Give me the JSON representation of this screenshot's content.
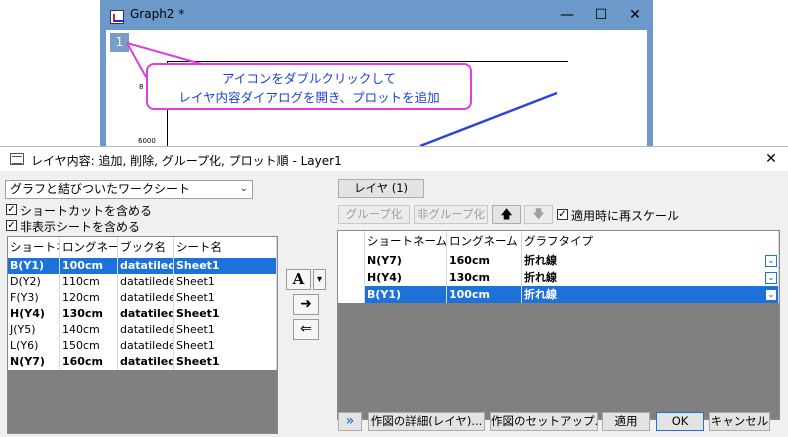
{
  "graph_window": {
    "title": "Graph2 *",
    "layer_number": "1",
    "minimize": "—",
    "maximize": "☐",
    "close": "✕",
    "ticks": [
      "8",
      "6000"
    ]
  },
  "callout": {
    "line1": "アイコンをダブルクリックして",
    "line2": "レイヤ内容ダイアログを開き、プロットを追加"
  },
  "dialog": {
    "title": "レイヤ内容: 追加, 削除, グループ化, プロット順 - Layer1",
    "close": "✕",
    "source_select": "グラフと結びついたワークシート",
    "include_shortcuts": "ショートカットを含める",
    "include_hidden": "非表示シートを含める",
    "left_table": {
      "headers": [
        "ショートネ",
        "ロングネーム",
        "ブック名",
        "シート名"
      ],
      "rows": [
        {
          "short": "B(Y1)",
          "long": "100cm",
          "book": "datatiled",
          "sheet": "Sheet1"
        },
        {
          "short": "D(Y2)",
          "long": "110cm",
          "book": "datatilede",
          "sheet": "Sheet1"
        },
        {
          "short": "F(Y3)",
          "long": "120cm",
          "book": "datatilede",
          "sheet": "Sheet1"
        },
        {
          "short": "H(Y4)",
          "long": "130cm",
          "book": "datatiled",
          "sheet": "Sheet1"
        },
        {
          "short": "J(Y5)",
          "long": "140cm",
          "book": "datatilede",
          "sheet": "Sheet1"
        },
        {
          "short": "L(Y6)",
          "long": "150cm",
          "book": "datatilede",
          "sheet": "Sheet1"
        },
        {
          "short": "N(Y7)",
          "long": "160cm",
          "book": "datatiled",
          "sheet": "Sheet1"
        }
      ]
    },
    "mid_buttons": {
      "plot_type": "A",
      "dropdown": "▾",
      "add": "➜",
      "remove": "⇐"
    },
    "layer_tab": "レイヤ (1)",
    "group_btn": "グループ化",
    "ungroup_btn": "非グループ化",
    "up_arrow": "🡅",
    "down_arrow": "🡇",
    "rescale_label": "適用時に再スケール",
    "right_table": {
      "headers": [
        "ショートネーム",
        "ロングネーム",
        "グラフタイプ"
      ],
      "rows": [
        {
          "short": "N(Y7)",
          "long": "160cm",
          "type": "折れ線"
        },
        {
          "short": "H(Y4)",
          "long": "130cm",
          "type": "折れ線"
        },
        {
          "short": "B(Y1)",
          "long": "100cm",
          "type": "折れ線"
        }
      ]
    },
    "footer": {
      "expand": "»",
      "plot_details": "作図の詳細(レイヤ)...",
      "plot_setup": "作図のセットアップ...",
      "apply": "適用",
      "ok": "OK",
      "cancel": "キャンセル"
    }
  }
}
